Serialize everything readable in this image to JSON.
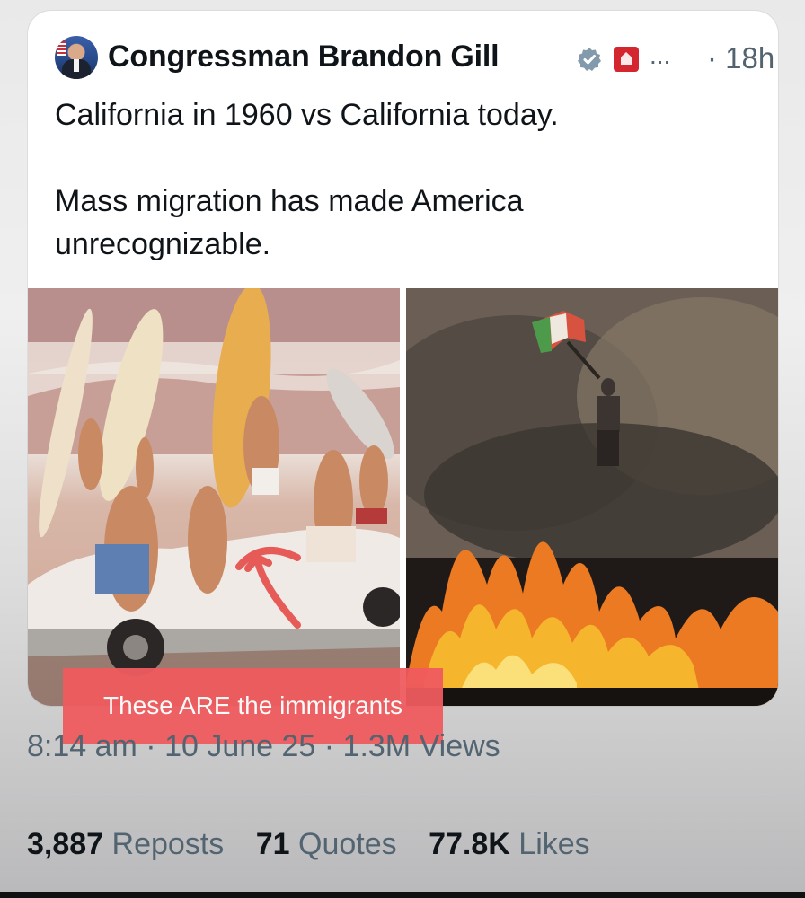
{
  "author": {
    "name": "Congressman Brandon Gill",
    "more": "...",
    "time": "· 18h"
  },
  "tweet": {
    "text": "California in 1960 vs California today.\n\nMass migration has made America unrecognizable."
  },
  "media": {
    "left_image": "beach-1960-photo",
    "right_image": "fire-protest-photo"
  },
  "overlay": {
    "caption": "These ARE the immigrants"
  },
  "meta": {
    "timestamp": "8:14 am · 10 June 25 · 1.3M Views"
  },
  "stats": [
    {
      "count": "3,887",
      "label": "Reposts"
    },
    {
      "count": "71",
      "label": "Quotes"
    },
    {
      "count": "77.8K",
      "label": "Likes"
    }
  ],
  "colors": {
    "verified": "#829aab",
    "caption_bg": "#ef5b5e",
    "gov_badge": "#d3262e"
  }
}
